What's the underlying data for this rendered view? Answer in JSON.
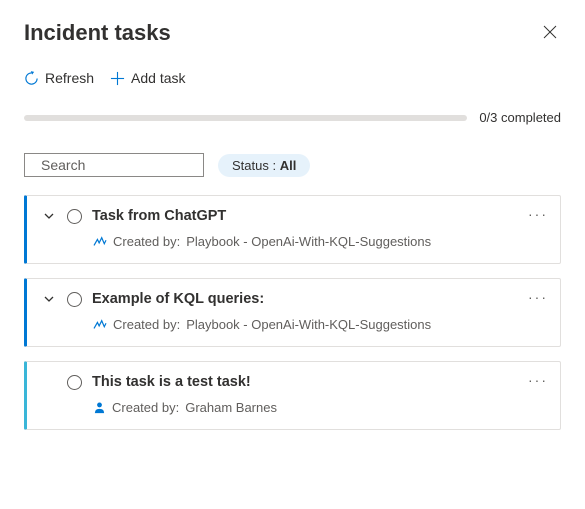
{
  "title": "Incident tasks",
  "toolbar": {
    "refresh": "Refresh",
    "add_task": "Add task"
  },
  "progress": {
    "completed": 0,
    "total": 3,
    "text": "0/3 completed"
  },
  "search": {
    "placeholder": "Search"
  },
  "status_filter": {
    "label": "Status :",
    "value": "All"
  },
  "tasks": [
    {
      "title": "Task from ChatGPT",
      "created_label": "Created by:",
      "created_by": "Playbook - OpenAi-With-KQL-Suggestions",
      "accent": "#0078d4",
      "expandable": true,
      "creator_type": "playbook",
      "more": "···"
    },
    {
      "title": "Example of KQL queries:",
      "created_label": "Created by:",
      "created_by": "Playbook - OpenAi-With-KQL-Suggestions",
      "accent": "#0078d4",
      "expandable": true,
      "creator_type": "playbook",
      "more": "···"
    },
    {
      "title": "This task is a test task!",
      "created_label": "Created by:",
      "created_by": "Graham Barnes",
      "accent": "#3ab6d8",
      "expandable": false,
      "creator_type": "user",
      "more": "···"
    }
  ]
}
